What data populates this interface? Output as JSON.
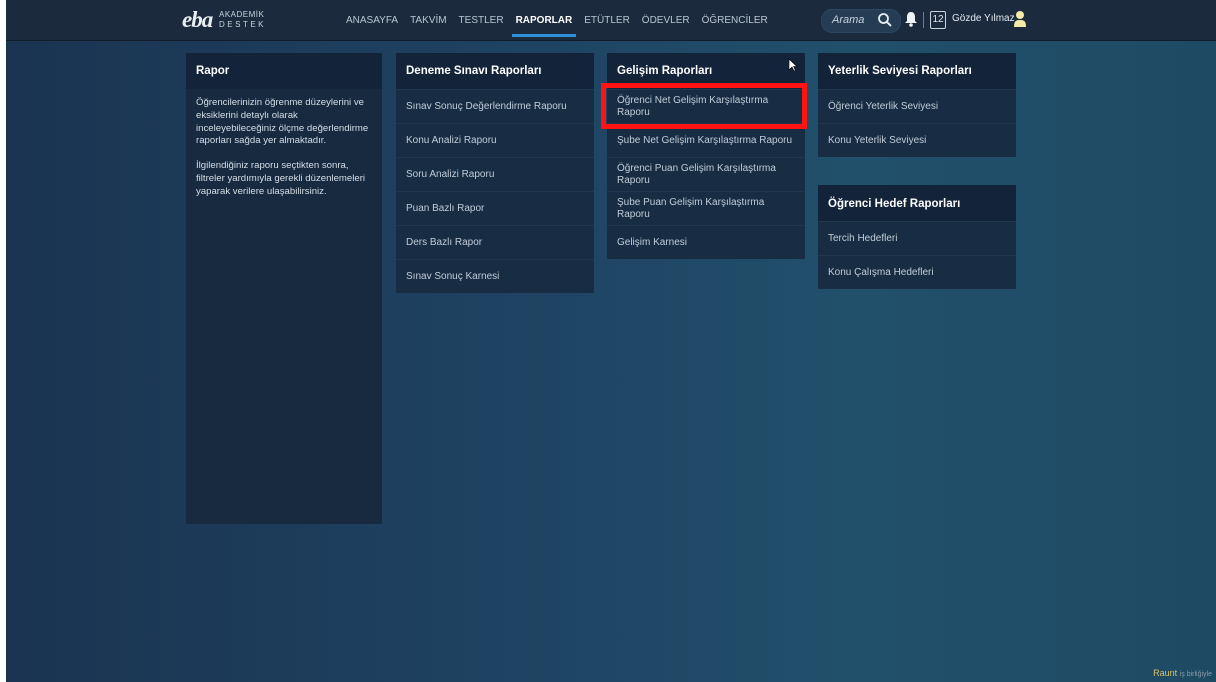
{
  "app": {
    "logo_main": "eba",
    "logo_sub1": "AKADEMİK",
    "logo_sub2": "DESTEK"
  },
  "nav": {
    "items": [
      "ANASAYFA",
      "TAKVİM",
      "TESTLER",
      "RAPORLAR",
      "ETÜTLER",
      "ÖDEVLER",
      "ÖĞRENCİLER"
    ],
    "active": "RAPORLAR"
  },
  "header": {
    "search_placeholder": "Arama",
    "calendar_day": "12",
    "username": "Gözde Yılmaz"
  },
  "rapor": {
    "title": "Rapor",
    "paragraph1": "Öğrencilerinizin öğrenme düzeylerini ve eksiklerini detaylı olarak inceleyebileceğiniz ölçme değerlendirme raporları sağda yer almaktadır.",
    "paragraph2": "İlgilendiğiniz raporu seçtikten sonra, filtreler yardımıyla gerekli düzenlemeleri yaparak verilere ulaşabilirsiniz."
  },
  "deneme": {
    "title": "Deneme Sınavı Raporları",
    "items": [
      "Sınav Sonuç Değerlendirme Raporu",
      "Konu Analizi Raporu",
      "Soru Analizi Raporu",
      "Puan Bazlı Rapor",
      "Ders Bazlı Rapor",
      "Sınav Sonuç Karnesi"
    ]
  },
  "gelisim": {
    "title": "Gelişim Raporları",
    "items": [
      "Öğrenci Net Gelişim Karşılaştırma Raporu",
      "Şube Net Gelişim Karşılaştırma Raporu",
      "Öğrenci Puan Gelişim Karşılaştırma Raporu",
      "Şube Puan Gelişim Karşılaştırma Raporu",
      "Gelişim Karnesi"
    ]
  },
  "yeterlik": {
    "title": "Yeterlik Seviyesi Raporları",
    "items": [
      "Öğrenci Yeterlik Seviyesi",
      "Konu Yeterlik Seviyesi"
    ]
  },
  "hedef": {
    "title": "Öğrenci Hedef Raporları",
    "items": [
      "Tercih Hedefleri",
      "Konu Çalışma Hedefleri"
    ]
  },
  "watermark": {
    "brand": "Raunt",
    "sub": "iş birliğiyle"
  },
  "colors": {
    "accent": "#2f8fd8",
    "highlight": "#ff1313"
  }
}
